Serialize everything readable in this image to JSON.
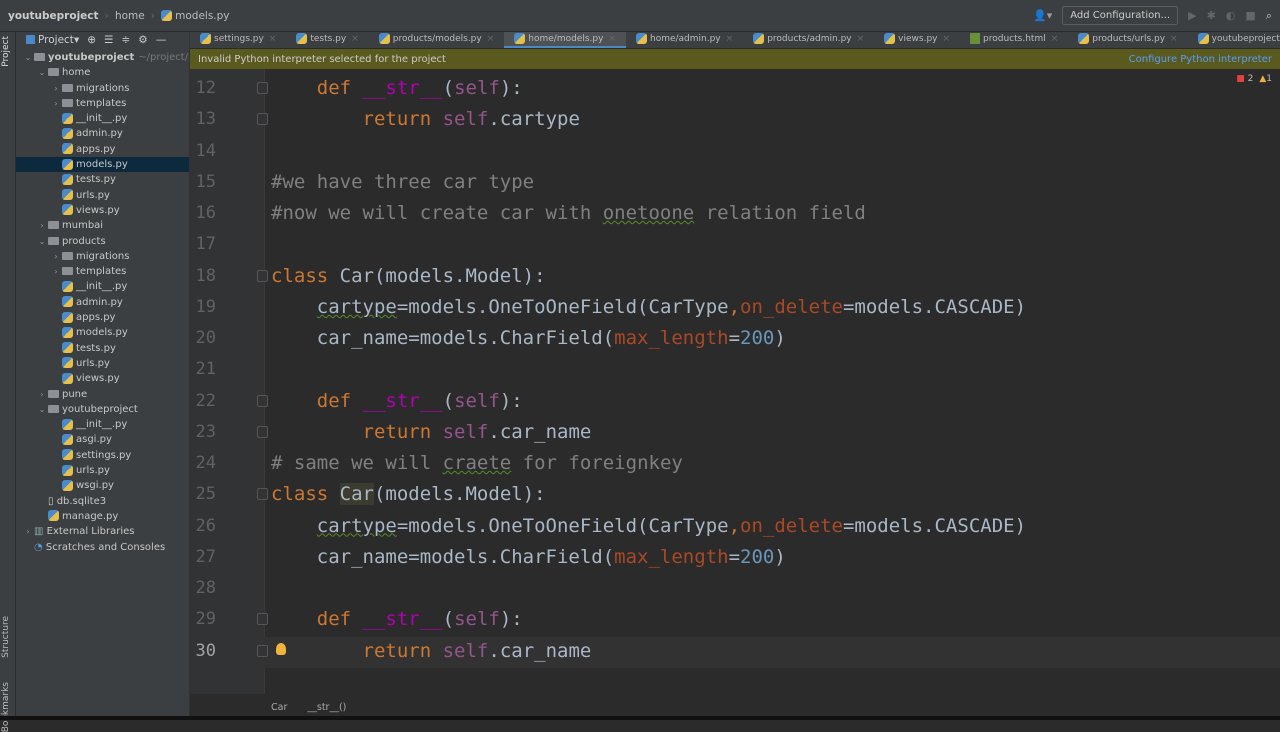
{
  "breadcrumb": {
    "project": "youtubeproject",
    "folder": "home",
    "file": "models.py"
  },
  "toolbar": {
    "add_configuration": "Add Configuration...",
    "icons": [
      "user-icon",
      "run-icon",
      "debug-icon",
      "coverage-icon",
      "stop-icon",
      "search-icon"
    ]
  },
  "tool_windows": {
    "project": "Project",
    "structure": "Structure",
    "bookmarks": "Bookmarks"
  },
  "sidebar": {
    "header": "Project",
    "items": [
      {
        "label": "youtubeproject",
        "hint": "~/project/pyt",
        "type": "folder",
        "depth": 0,
        "open": true,
        "bold": true
      },
      {
        "label": "home",
        "type": "folder",
        "depth": 1,
        "open": true
      },
      {
        "label": "migrations",
        "type": "folder",
        "depth": 2,
        "open": false
      },
      {
        "label": "templates",
        "type": "folder",
        "depth": 2,
        "open": false
      },
      {
        "label": "__init__.py",
        "type": "py",
        "depth": 2
      },
      {
        "label": "admin.py",
        "type": "py",
        "depth": 2
      },
      {
        "label": "apps.py",
        "type": "py",
        "depth": 2
      },
      {
        "label": "models.py",
        "type": "py",
        "depth": 2,
        "selected": true
      },
      {
        "label": "tests.py",
        "type": "py",
        "depth": 2
      },
      {
        "label": "urls.py",
        "type": "py",
        "depth": 2
      },
      {
        "label": "views.py",
        "type": "py",
        "depth": 2
      },
      {
        "label": "mumbai",
        "type": "folder",
        "depth": 1,
        "open": false
      },
      {
        "label": "products",
        "type": "folder",
        "depth": 1,
        "open": true
      },
      {
        "label": "migrations",
        "type": "folder",
        "depth": 2,
        "open": false
      },
      {
        "label": "templates",
        "type": "folder",
        "depth": 2,
        "open": false
      },
      {
        "label": "__init__.py",
        "type": "py",
        "depth": 2
      },
      {
        "label": "admin.py",
        "type": "py",
        "depth": 2
      },
      {
        "label": "apps.py",
        "type": "py",
        "depth": 2
      },
      {
        "label": "models.py",
        "type": "py",
        "depth": 2
      },
      {
        "label": "tests.py",
        "type": "py",
        "depth": 2
      },
      {
        "label": "urls.py",
        "type": "py",
        "depth": 2
      },
      {
        "label": "views.py",
        "type": "py",
        "depth": 2
      },
      {
        "label": "pune",
        "type": "folder",
        "depth": 1,
        "open": false
      },
      {
        "label": "youtubeproject",
        "type": "folder",
        "depth": 1,
        "open": true
      },
      {
        "label": "__init__.py",
        "type": "py",
        "depth": 2
      },
      {
        "label": "asgi.py",
        "type": "py",
        "depth": 2
      },
      {
        "label": "settings.py",
        "type": "py",
        "depth": 2
      },
      {
        "label": "urls.py",
        "type": "py",
        "depth": 2
      },
      {
        "label": "wsgi.py",
        "type": "py",
        "depth": 2
      },
      {
        "label": "db.sqlite3",
        "type": "file",
        "depth": 1
      },
      {
        "label": "manage.py",
        "type": "py",
        "depth": 1
      },
      {
        "label": "External Libraries",
        "type": "lib",
        "depth": 0,
        "open": false
      },
      {
        "label": "Scratches and Consoles",
        "type": "scratch",
        "depth": 0
      }
    ]
  },
  "tabs": [
    {
      "label": "settings.py",
      "type": "py"
    },
    {
      "label": "tests.py",
      "type": "py"
    },
    {
      "label": "products/models.py",
      "type": "py"
    },
    {
      "label": "home/models.py",
      "type": "py",
      "active": true
    },
    {
      "label": "home/admin.py",
      "type": "py"
    },
    {
      "label": "products/admin.py",
      "type": "py"
    },
    {
      "label": "views.py",
      "type": "py"
    },
    {
      "label": "products.html",
      "type": "html"
    },
    {
      "label": "products/urls.py",
      "type": "py"
    },
    {
      "label": "youtubeproject/urls.py",
      "type": "py"
    }
  ],
  "banner": {
    "message": "Invalid Python interpreter selected for the project",
    "action": "Configure Python interpreter"
  },
  "inspections": {
    "errors": "2",
    "warnings": "1"
  },
  "editor": {
    "current_line": 30,
    "lines": [
      {
        "n": 12,
        "t": [
          [
            "    ",
            "pl"
          ],
          [
            "def",
            "kw"
          ],
          [
            " ",
            "pl"
          ],
          [
            "__str__",
            "dn"
          ],
          [
            "(",
            "pl"
          ],
          [
            "self",
            "sf"
          ],
          [
            "):",
            "pl"
          ]
        ],
        "fold": true
      },
      {
        "n": 13,
        "t": [
          [
            "        ",
            "pl"
          ],
          [
            "return",
            "kw"
          ],
          [
            " ",
            "pl"
          ],
          [
            "self",
            "sf"
          ],
          [
            ".cartype",
            "pl"
          ]
        ],
        "fold": true
      },
      {
        "n": 14,
        "t": []
      },
      {
        "n": 15,
        "t": [
          [
            "#we have three car type",
            "cm"
          ]
        ]
      },
      {
        "n": 16,
        "t": [
          [
            "#now we will create car with ",
            "cm"
          ],
          [
            "onetoone",
            "cm wv"
          ],
          [
            " relation field",
            "cm"
          ]
        ]
      },
      {
        "n": 17,
        "t": []
      },
      {
        "n": 18,
        "t": [
          [
            "class",
            "kw"
          ],
          [
            " Car(models.Model):",
            "pl"
          ]
        ],
        "fold": true
      },
      {
        "n": 19,
        "t": [
          [
            "    ",
            "pl"
          ],
          [
            "cartype",
            "pl wv"
          ],
          [
            "=models.OneToOneField(CarType",
            ""
          ],
          [
            ",",
            "kw"
          ],
          [
            "on_delete",
            "kwa"
          ],
          [
            "=models.CASCADE)",
            "pl"
          ]
        ]
      },
      {
        "n": 20,
        "t": [
          [
            "    car_name=models.CharField(",
            "pl"
          ],
          [
            "max_length",
            "kwa"
          ],
          [
            "=",
            "pl"
          ],
          [
            "200",
            "num"
          ],
          [
            ")",
            "pl"
          ]
        ]
      },
      {
        "n": 21,
        "t": []
      },
      {
        "n": 22,
        "t": [
          [
            "    ",
            "pl"
          ],
          [
            "def",
            "kw"
          ],
          [
            " ",
            "pl"
          ],
          [
            "__str__",
            "dn"
          ],
          [
            "(",
            "pl"
          ],
          [
            "self",
            "sf"
          ],
          [
            "):",
            "pl"
          ]
        ],
        "fold": true
      },
      {
        "n": 23,
        "t": [
          [
            "        ",
            "pl"
          ],
          [
            "return",
            "kw"
          ],
          [
            " ",
            "pl"
          ],
          [
            "self",
            "sf"
          ],
          [
            ".car_name",
            "pl"
          ]
        ],
        "fold": true
      },
      {
        "n": 24,
        "t": [
          [
            "# same we will ",
            "cm"
          ],
          [
            "craete",
            "cm wv"
          ],
          [
            " for foreignkey",
            "cm"
          ]
        ]
      },
      {
        "n": 25,
        "t": [
          [
            "class",
            "kw"
          ],
          [
            " ",
            "pl"
          ],
          [
            "Car",
            "pl hl"
          ],
          [
            "(models.Model):",
            "pl"
          ]
        ],
        "fold": true
      },
      {
        "n": 26,
        "t": [
          [
            "    ",
            "pl"
          ],
          [
            "cartype",
            "pl wv"
          ],
          [
            "=models.OneToOneField(CarType",
            ""
          ],
          [
            ",",
            "kw"
          ],
          [
            "on_delete",
            "kwa"
          ],
          [
            "=models.CASCADE)",
            "pl"
          ]
        ]
      },
      {
        "n": 27,
        "t": [
          [
            "    car_name=models.CharField(",
            "pl"
          ],
          [
            "max_length",
            "kwa"
          ],
          [
            "=",
            "pl"
          ],
          [
            "200",
            "num"
          ],
          [
            ")",
            "pl"
          ]
        ]
      },
      {
        "n": 28,
        "t": []
      },
      {
        "n": 29,
        "t": [
          [
            "    ",
            "pl"
          ],
          [
            "def",
            "kw"
          ],
          [
            " ",
            "pl"
          ],
          [
            "__str__",
            "dn"
          ],
          [
            "(",
            "pl"
          ],
          [
            "self",
            "sf"
          ],
          [
            "):",
            "pl"
          ]
        ],
        "fold": true
      },
      {
        "n": 30,
        "t": [
          [
            "        ",
            "pl"
          ],
          [
            "return",
            "kw"
          ],
          [
            " ",
            "pl"
          ],
          [
            "self",
            "sf"
          ],
          [
            ".car_name",
            "pl"
          ]
        ],
        "fold": true
      }
    ]
  },
  "editor_breadcrumb": [
    "Car",
    "__str__()"
  ],
  "colors": {
    "keyword": "#cc7832",
    "dunder": "#b200b2",
    "self": "#94558d",
    "kwarg": "#aa4926",
    "number": "#6897bb",
    "comment": "#808080",
    "text": "#a9b7c6",
    "banner": "#5a5a1f",
    "selection": "#0d293e"
  }
}
